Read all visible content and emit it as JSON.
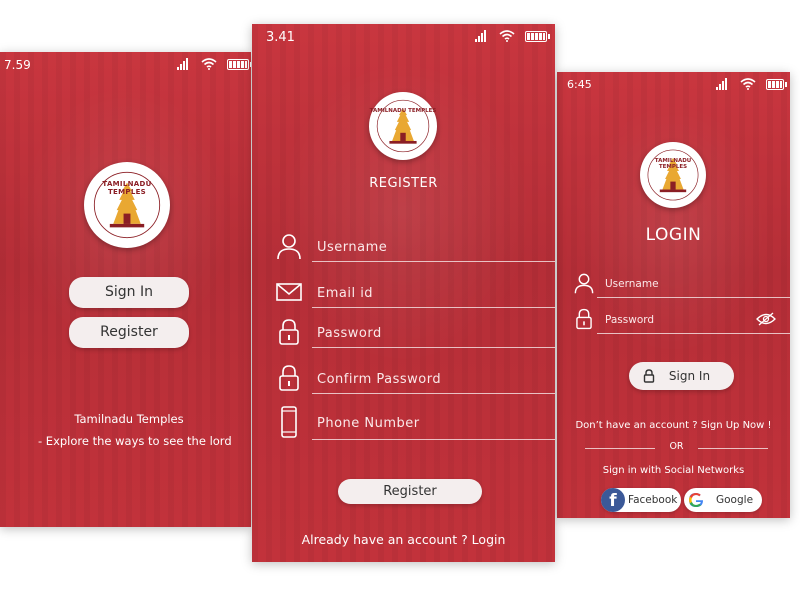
{
  "left_screen": {
    "time": "7.59",
    "logo_text": "TAMILNADU TEMPLES",
    "sign_in_label": "Sign In",
    "register_label": "Register",
    "tagline_title": "Tamilnadu Temples",
    "tagline_sub": "- Explore the ways to see the lord"
  },
  "middle_screen": {
    "time": "3.41",
    "logo_text": "TAMILNADU TEMPLES",
    "title": "REGISTER",
    "fields": {
      "username": "Username",
      "email": "Email id",
      "password": "Password",
      "confirm": "Confirm Password",
      "phone": "Phone Number"
    },
    "register_button": "Register",
    "footer_link": "Already have an account ? Login"
  },
  "right_screen": {
    "time": "6:45",
    "logo_text": "TAMILNADU TEMPLES",
    "title": "LOGIN",
    "username_label": "Username",
    "password_label": "Password",
    "sign_in_button": "Sign In",
    "signup_text": "Don’t have an account ? Sign Up Now !",
    "or_text": "OR",
    "social_text": "Sign in with Social Networks",
    "facebook_label": "Facebook",
    "google_label": "Google"
  },
  "colors": {
    "brand_red": "#c2323b",
    "button_bg": "#f4eeee",
    "logo_gold": "#e9a832",
    "logo_maroon": "#8b1e24"
  }
}
